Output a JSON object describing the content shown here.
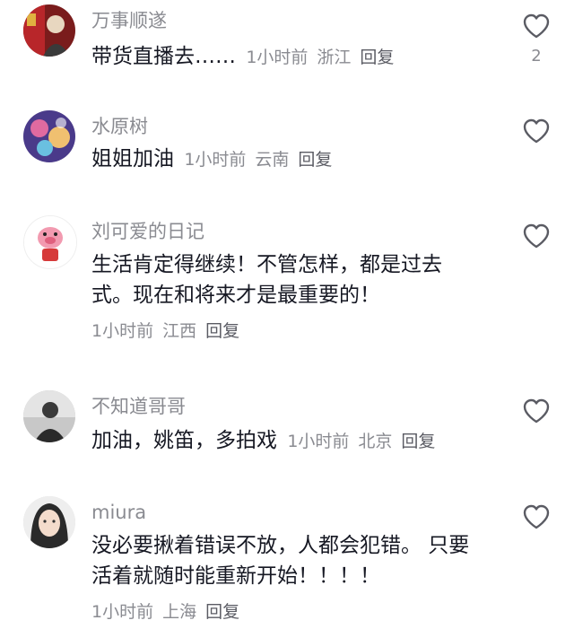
{
  "comments": [
    {
      "username": "万事顺遂",
      "text": "带货直播去……",
      "time": "1小时前",
      "location": "浙江",
      "reply": "回复",
      "like_count": "2",
      "icon": "heart-outline-icon"
    },
    {
      "username": "水原树",
      "text": "姐姐加油",
      "time": "1小时前",
      "location": "云南",
      "reply": "回复",
      "icon": "heart-outline-icon"
    },
    {
      "username": "刘可爱的日记",
      "text": "生活肯定得继续！不管怎样，都是过去式。现在和将来才是最重要的！",
      "time": "1小时前",
      "location": "江西",
      "reply": "回复",
      "icon": "heart-outline-icon"
    },
    {
      "username": "不知道哥哥",
      "text": "加油，姚笛，多拍戏",
      "time": "1小时前",
      "location": "北京",
      "reply": "回复",
      "icon": "heart-outline-icon"
    },
    {
      "username": "miura",
      "text": "没必要揪着错误不放，人都会犯错。 只要活着就随时能重新开始！！！！",
      "time": "1小时前",
      "location": "上海",
      "reply": "回复",
      "icon": "heart-outline-icon"
    }
  ]
}
